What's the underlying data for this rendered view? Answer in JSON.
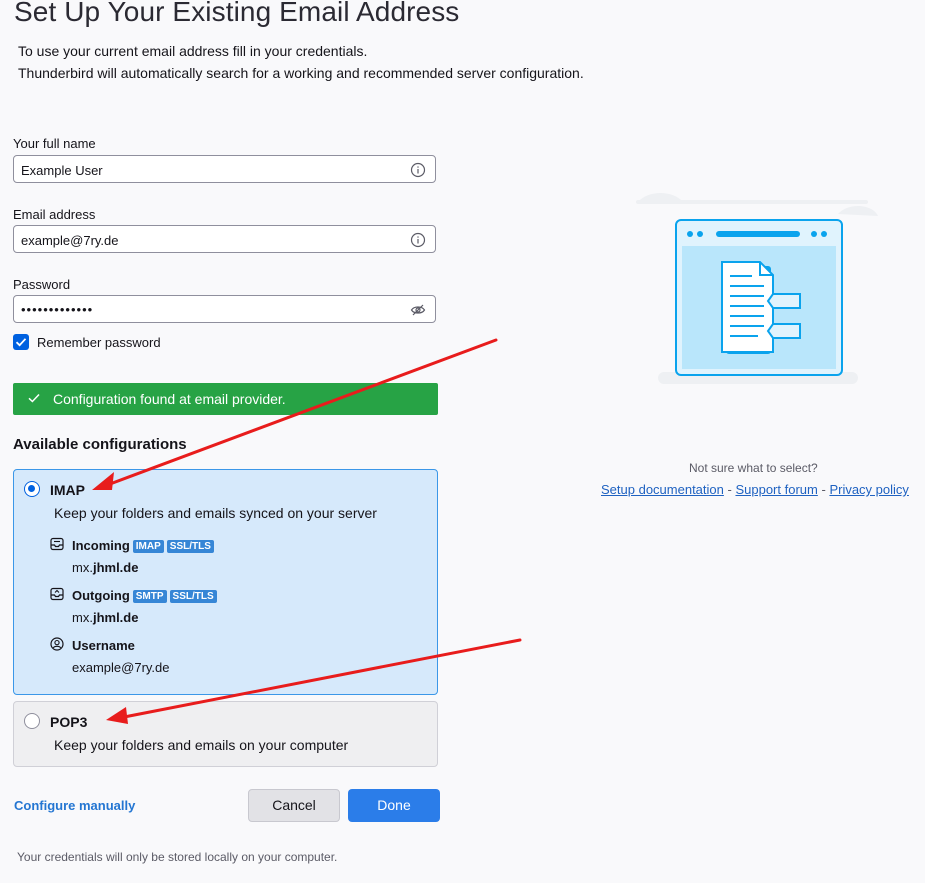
{
  "header": {
    "title": "Set Up Your Existing Email Address",
    "intro_line1": "To use your current email address fill in your credentials.",
    "intro_line2": "Thunderbird will automatically search for a working and recommended server configuration."
  },
  "form": {
    "full_name": {
      "label": "Your full name",
      "value": "Example User",
      "icon": "info-icon"
    },
    "email": {
      "label": "Email address",
      "value": "example@7ry.de",
      "icon": "info-icon"
    },
    "password": {
      "label": "Password",
      "value": "•••••••••••••",
      "icon": "eye-slash-icon"
    },
    "remember": {
      "label": "Remember password",
      "checked": true
    }
  },
  "status": {
    "text": "Configuration found at email provider.",
    "icon": "checkmark-icon",
    "color": "#27a345"
  },
  "configurations": {
    "heading": "Available configurations",
    "imap": {
      "title": "IMAP",
      "description": "Keep your folders and emails synced on your server",
      "selected": true,
      "incoming": {
        "label": "Incoming",
        "badges": [
          "IMAP",
          "SSL/TLS"
        ],
        "host_prefix": "mx.",
        "host_domain": "jhml.de",
        "icon": "inbox-icon"
      },
      "outgoing": {
        "label": "Outgoing",
        "badges": [
          "SMTP",
          "SSL/TLS"
        ],
        "host_prefix": "mx.",
        "host_domain": "jhml.de",
        "icon": "outbox-icon"
      },
      "username": {
        "label": "Username",
        "value": "example@7ry.de",
        "icon": "user-icon"
      }
    },
    "pop3": {
      "title": "POP3",
      "description": "Keep your folders and emails on your computer",
      "selected": false
    }
  },
  "actions": {
    "configure_manually": "Configure manually",
    "cancel": "Cancel",
    "done": "Done"
  },
  "footer": {
    "note": "Your credentials will only be stored locally on your computer."
  },
  "help": {
    "question": "Not sure what to select?",
    "setup_doc": "Setup documentation",
    "support_forum": "Support forum",
    "privacy_policy": "Privacy policy",
    "separator": "-"
  },
  "colors": {
    "accent": "#2b7de9",
    "selected_card": "#d6e9fb",
    "annotation_arrow": "#e81c1c"
  }
}
